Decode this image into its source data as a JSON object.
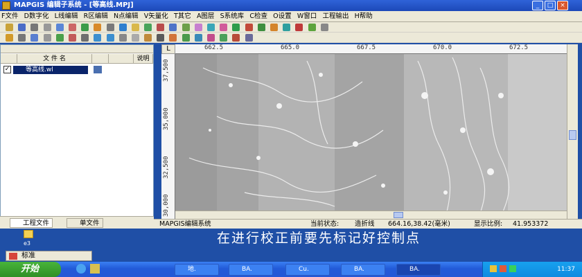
{
  "window": {
    "title": "MAPGIS 编辑子系统 - [等高线.MPJ]"
  },
  "menu": [
    "F文件",
    "D数字化",
    "L线编辑",
    "R区编辑",
    "N点编辑",
    "V矢量化",
    "T其它",
    "A图层",
    "S系统库",
    "C检查",
    "O设置",
    "W窗口",
    "工程输出",
    "H帮助"
  ],
  "left_panel": {
    "columns": [
      "文 件 名",
      "",
      "",
      "说明"
    ],
    "file_name": "等高线.wl",
    "tabs": [
      "工程文件",
      "单文件"
    ]
  },
  "ruler": {
    "top_labels": [
      "662.5",
      "665.0",
      "667.5",
      "670.0",
      "672.5"
    ],
    "left_labels": [
      "37,500",
      "35,000",
      "32,500",
      "30,000"
    ]
  },
  "status": {
    "app": "MAPGIS编辑系统",
    "state_label": "当前状态:",
    "state_value": "造折线",
    "coords": "664.16,38.42(毫米)",
    "scale_label": "显示比例:",
    "scale_value": "41.953372"
  },
  "caption": "在进行校正前要先标记好控制点",
  "desktop_icon_label": "e3",
  "language_bar": {
    "label": "标准"
  },
  "taskbar": {
    "start": "开始",
    "tasks": [
      "地.",
      "BA.",
      "Cu.",
      "BA.",
      "BA."
    ],
    "time": "11:37"
  },
  "colors": {
    "titlebar": "#2f63d8",
    "taskbar": "#225ad8",
    "start": "#3c9c31",
    "canvas": "#9a9a9a"
  }
}
